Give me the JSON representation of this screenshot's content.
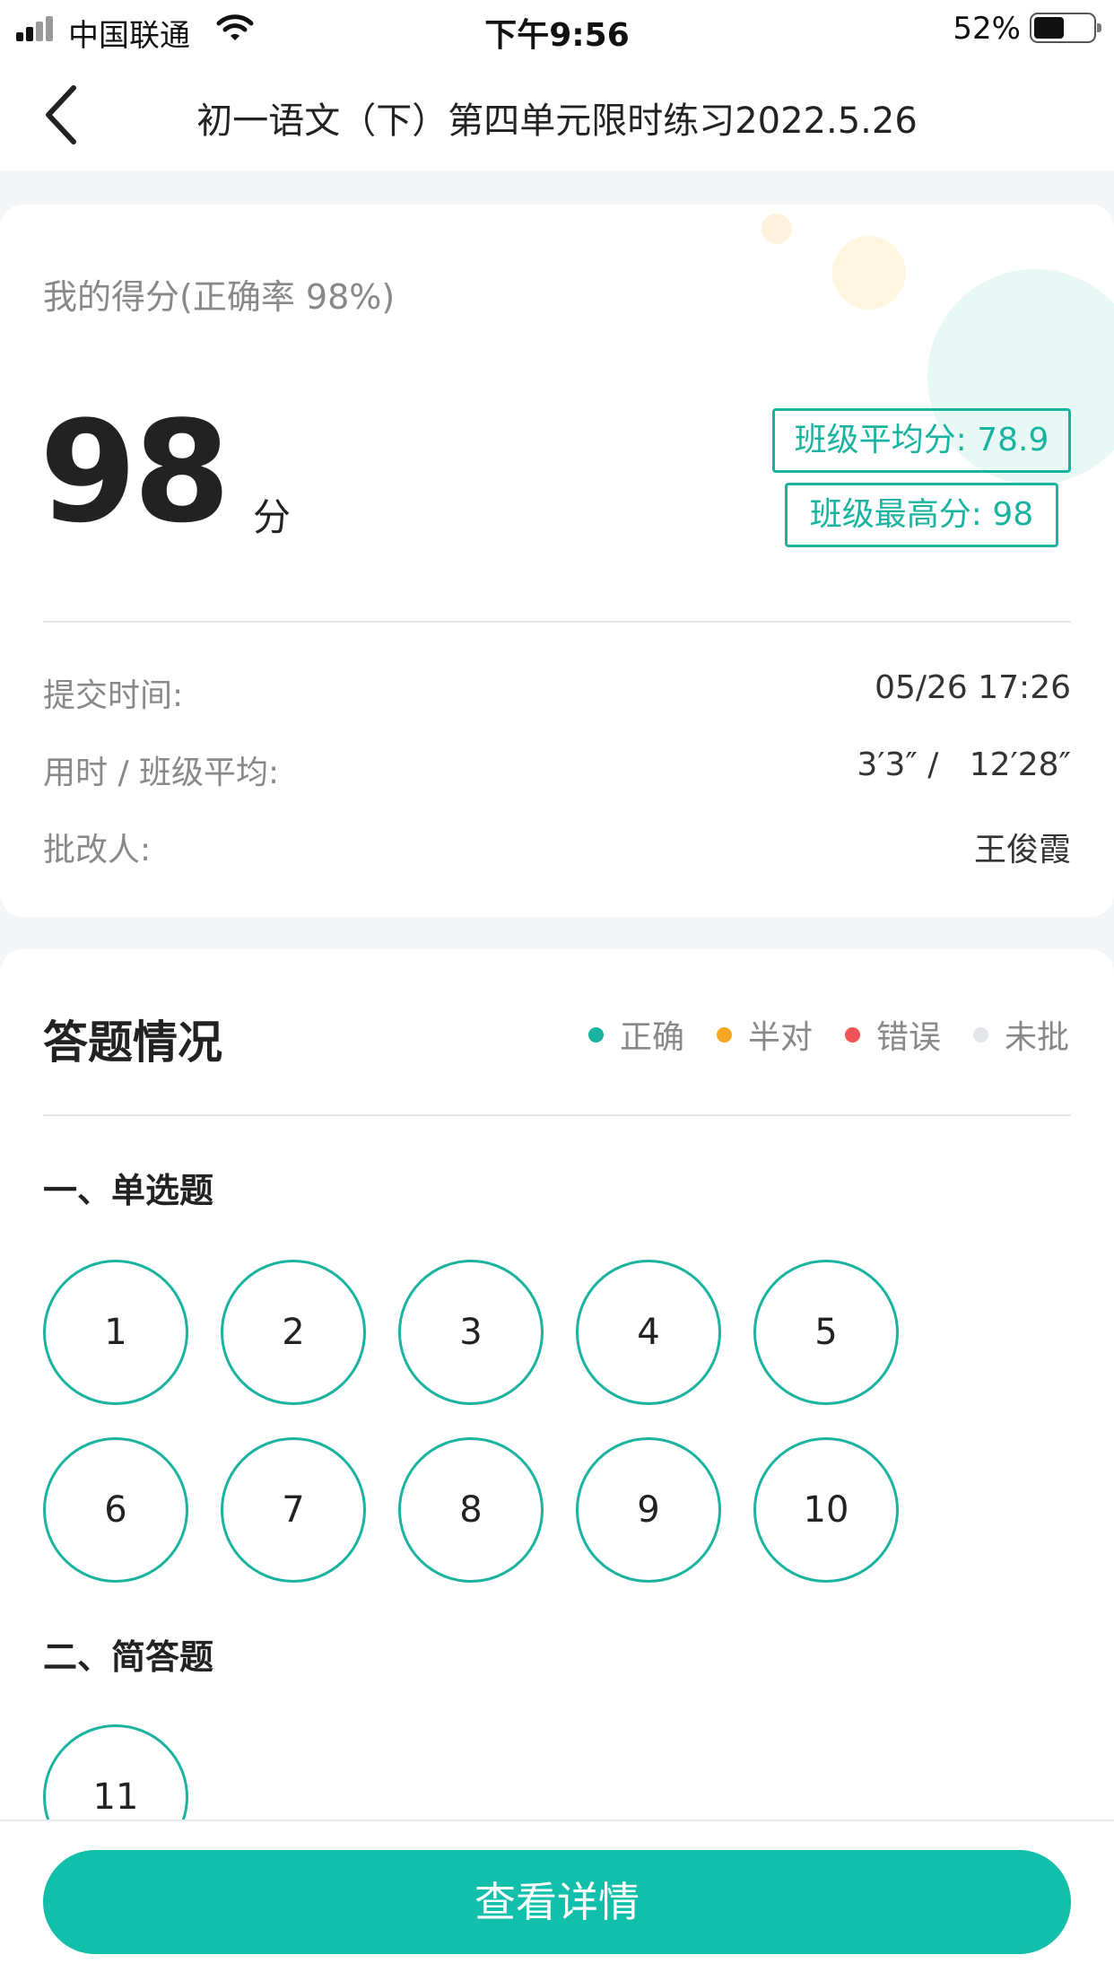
{
  "status_bar": {
    "carrier": "中国联通",
    "time": "下午9:56",
    "battery_pct": "52%",
    "battery_level": 0.52
  },
  "nav": {
    "title": "初一语文（下）第四单元限时练习2022.5.26"
  },
  "score": {
    "label": "我的得分(正确率 98%)",
    "value": "98",
    "unit": "分",
    "class_avg": "班级平均分: 78.9",
    "class_max": "班级最高分: 98",
    "submit_label": "提交时间:",
    "submit_value": "05/26 17:26",
    "duration_label": "用时 / 班级平均:",
    "duration_value": "3′3″ /   12′28″",
    "grader_label": "批改人:",
    "grader_value": "王俊霞"
  },
  "answers": {
    "title": "答题情况",
    "legend": [
      {
        "label": "正确",
        "color": "#1ab3a0"
      },
      {
        "label": "半对",
        "color": "#f5a623"
      },
      {
        "label": "错误",
        "color": "#f05454"
      },
      {
        "label": "未批",
        "color": "#e3e5e8"
      }
    ],
    "sections": [
      {
        "title": "一、单选题",
        "questions": [
          "1",
          "2",
          "3",
          "4",
          "5",
          "6",
          "7",
          "8",
          "9",
          "10"
        ]
      },
      {
        "title": "二、简答题",
        "questions": [
          "11"
        ]
      }
    ]
  },
  "footer": {
    "button_label": "查看详情"
  },
  "colors": {
    "accent": "#12bfaa",
    "correct_border": "#1ab3a0"
  }
}
